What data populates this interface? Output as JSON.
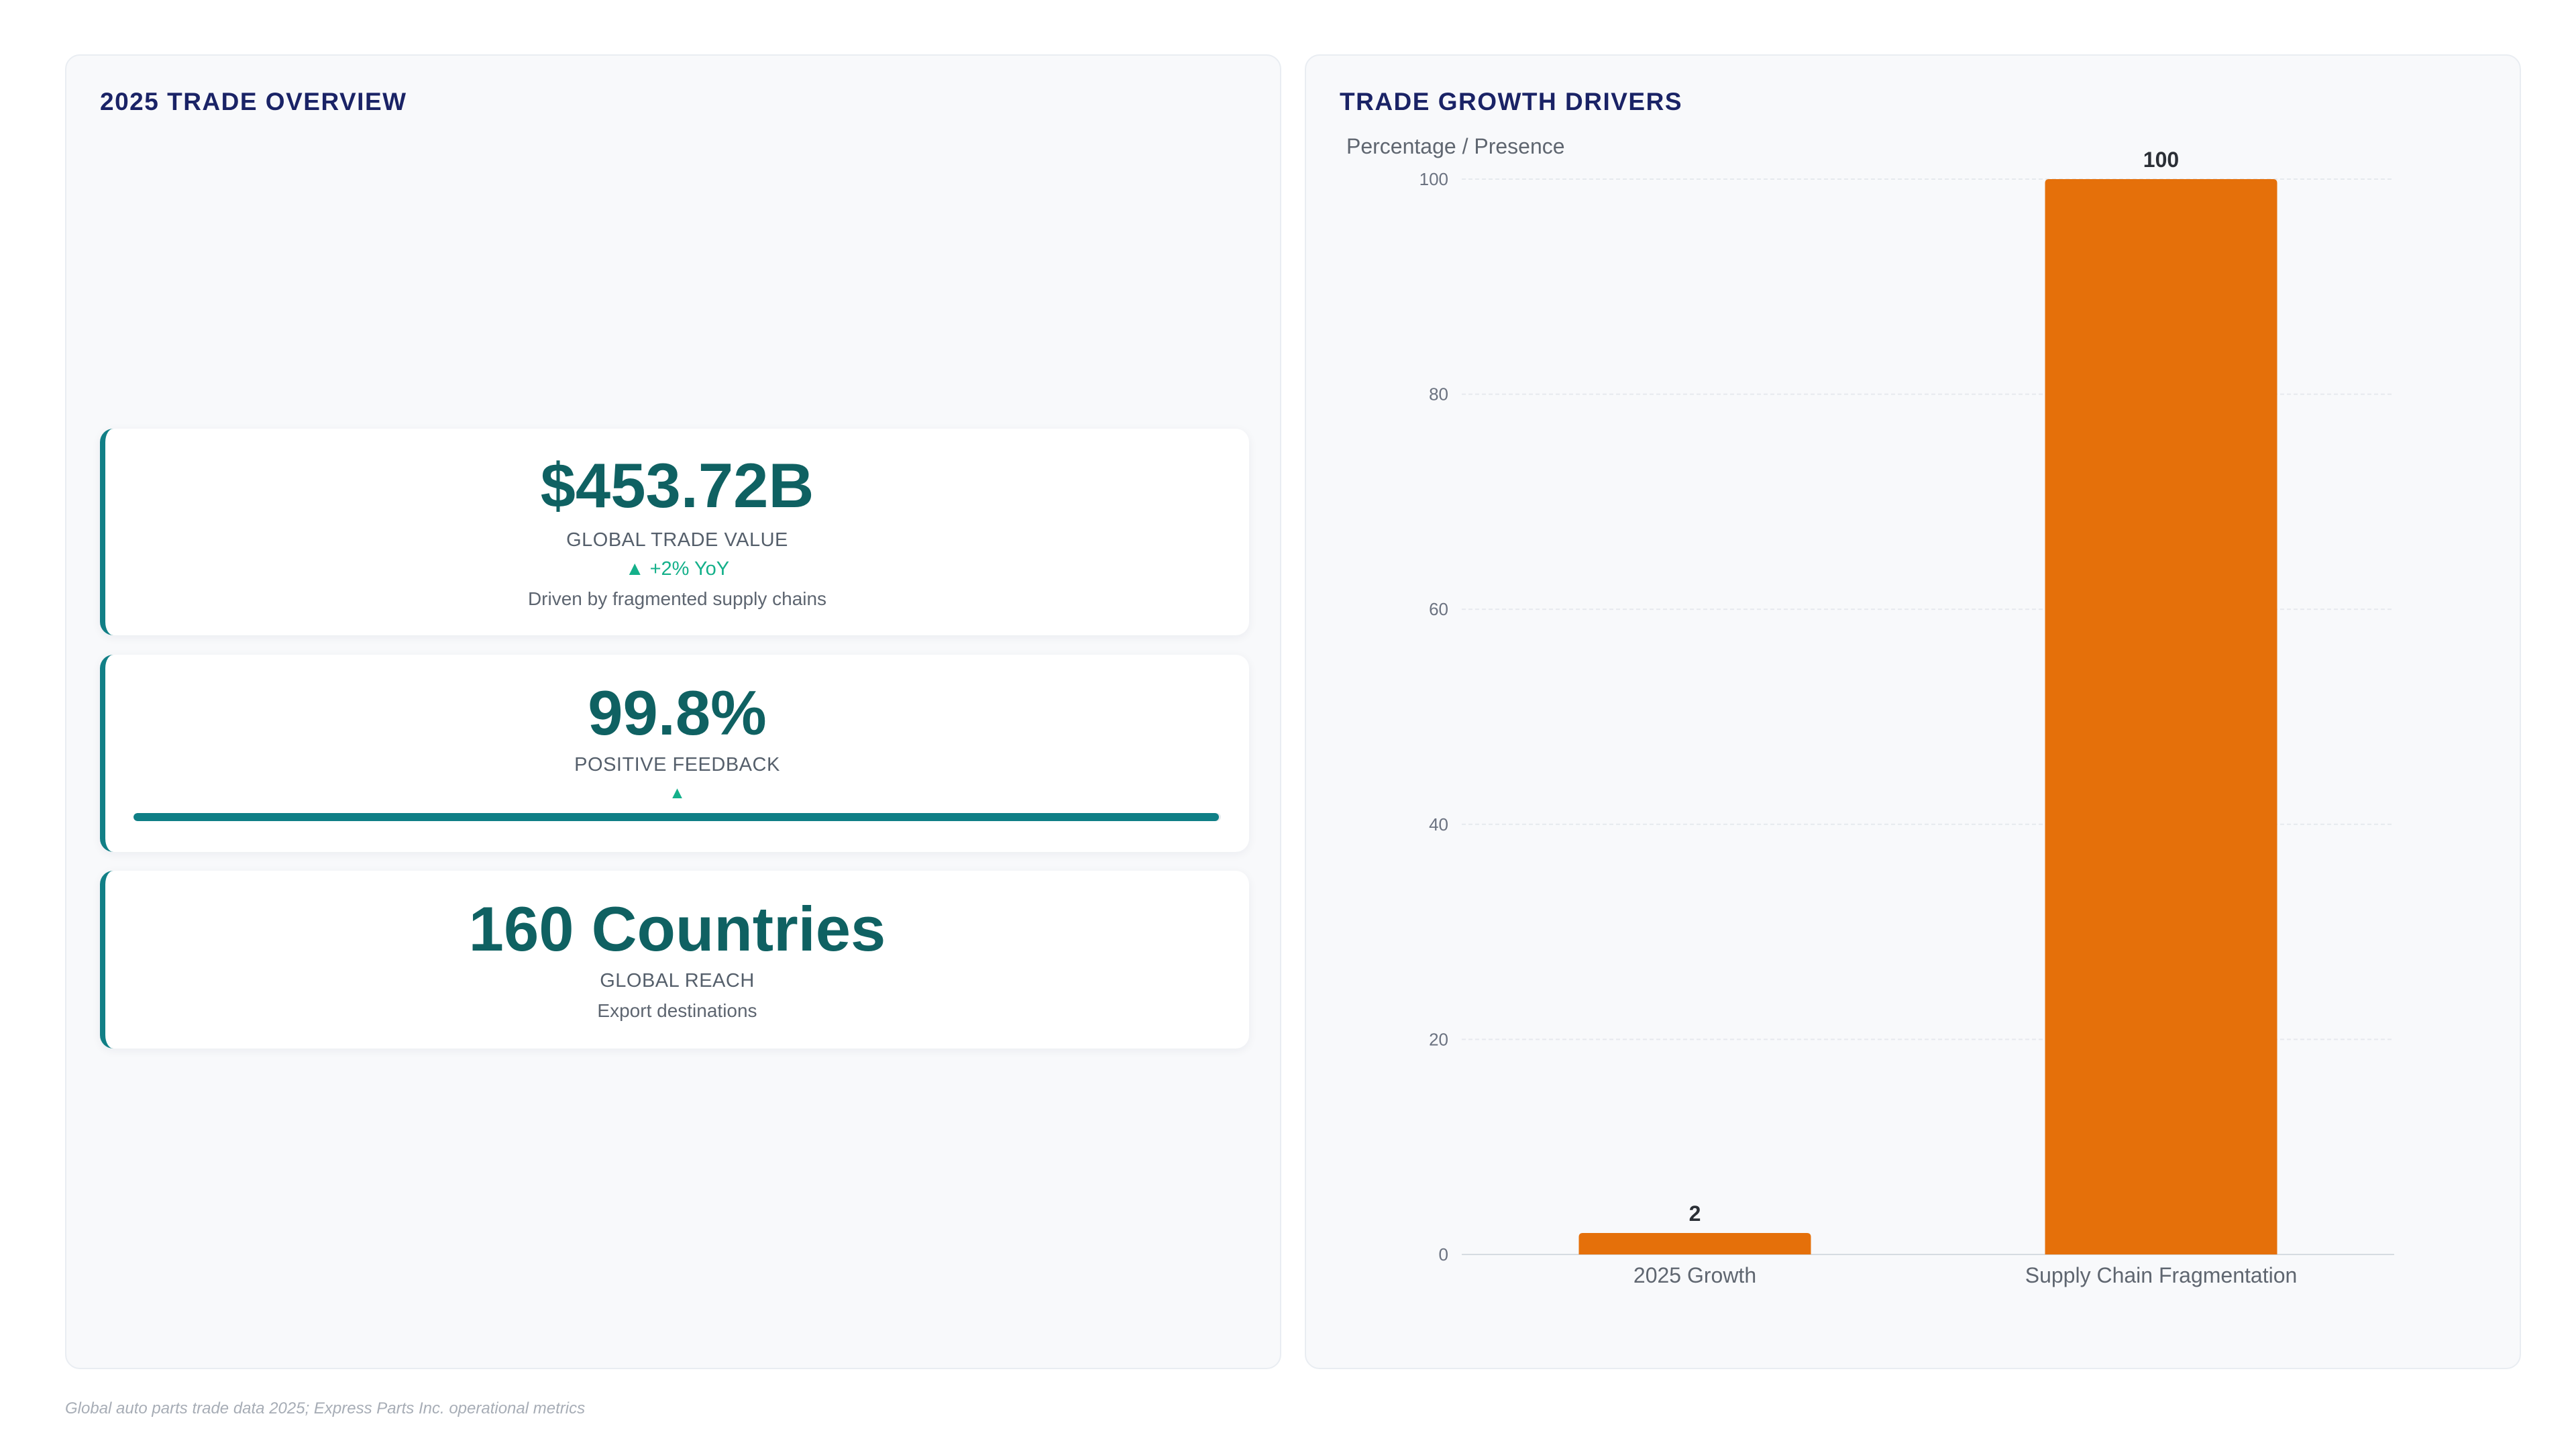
{
  "left_panel": {
    "title": "2025 TRADE OVERVIEW",
    "kpis": [
      {
        "value": "$453.72B",
        "label": "GLOBAL TRADE VALUE",
        "trend": "▲ +2% YoY",
        "note": "Driven by fragmented supply chains"
      },
      {
        "value": "99.8%",
        "label": "POSITIVE FEEDBACK",
        "trend": "▲",
        "progress": 99.8
      },
      {
        "value": "160 Countries",
        "label": "GLOBAL REACH",
        "note": "Export destinations"
      }
    ]
  },
  "right_panel": {
    "title": "TRADE GROWTH DRIVERS"
  },
  "chart_data": {
    "type": "bar",
    "title": "TRADE GROWTH DRIVERS",
    "ylabel": "Percentage / Presence",
    "xlabel": "",
    "categories": [
      "2025 Growth",
      "Supply Chain Fragmentation"
    ],
    "values": [
      2,
      100
    ],
    "data_labels": [
      "2",
      "100"
    ],
    "ylim": [
      0,
      100
    ],
    "yticks": [
      0,
      20,
      40,
      60,
      80,
      100
    ],
    "grid": true,
    "bar_color": "#e5700a",
    "legend": "none"
  },
  "colors": {
    "accent_teal": "#0f7f86",
    "title_navy": "#1a2366",
    "trend_green": "#14b08a",
    "bar_orange": "#e5700a"
  },
  "footer": {
    "source": "Global auto parts trade data 2025; Express Parts Inc. operational metrics"
  }
}
